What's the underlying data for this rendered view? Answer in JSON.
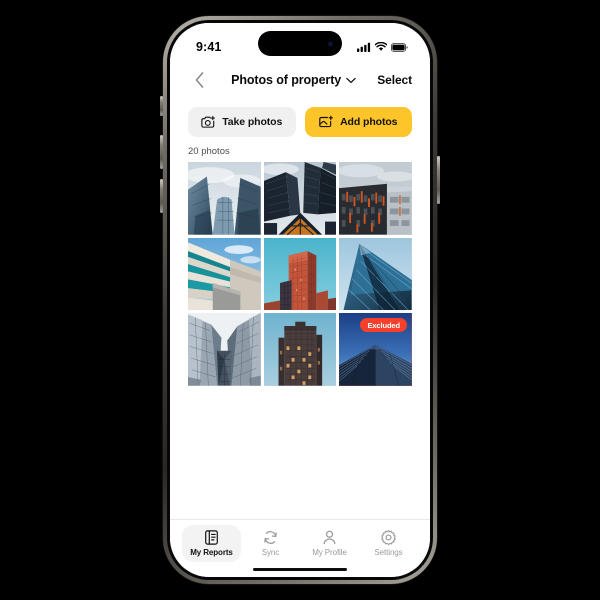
{
  "device": {
    "name": "smartphone",
    "status_bar": {
      "time": "9:41",
      "icons": [
        "cellular-signal-icon",
        "wifi-icon",
        "battery-icon"
      ]
    },
    "home_indicator": true
  },
  "header": {
    "back_icon": "chevron-left-icon",
    "title": "Photos of property",
    "title_dropdown_icon": "chevron-down-icon",
    "select_label": "Select"
  },
  "actions": {
    "take_photos": {
      "label": "Take photos",
      "icon": "camera-plus-icon",
      "bg": "#f0f0f1"
    },
    "add_photos": {
      "label": "Add photos",
      "icon": "image-plus-icon",
      "bg": "#fdc52a"
    }
  },
  "gallery": {
    "count_label": "20 photos",
    "columns": 3,
    "photos": [
      {
        "id": 1,
        "alt": "curved glass office building from below",
        "excluded": false
      },
      {
        "id": 2,
        "alt": "dark skyscrapers looking upward with lit atrium",
        "excluded": false
      },
      {
        "id": 3,
        "alt": "dark facade with orange vertical accents",
        "excluded": false
      },
      {
        "id": 4,
        "alt": "concrete balconies with teal glazing",
        "excluded": false
      },
      {
        "id": 5,
        "alt": "orange brick tower against teal sky",
        "excluded": false
      },
      {
        "id": 6,
        "alt": "blue glass tower perspective upward",
        "excluded": false
      },
      {
        "id": 7,
        "alt": "faceted glass towers converging",
        "excluded": false
      },
      {
        "id": 8,
        "alt": "dark residential tower with lit windows",
        "excluded": false
      },
      {
        "id": 9,
        "alt": "modern building corner at dusk",
        "excluded": true,
        "badge": "Excluded"
      }
    ]
  },
  "tabbar": {
    "items": [
      {
        "label": "My Reports",
        "icon": "document-icon",
        "active": true
      },
      {
        "label": "Sync",
        "icon": "refresh-icon",
        "active": false
      },
      {
        "label": "My Profile",
        "icon": "person-icon",
        "active": false
      },
      {
        "label": "Settings",
        "icon": "gear-icon",
        "active": false
      }
    ]
  },
  "colors": {
    "accent_yellow": "#fdc52a",
    "excluded_red": "#f6402c",
    "page_bg": "#ffffff",
    "muted_text": "#9b9b9f"
  }
}
